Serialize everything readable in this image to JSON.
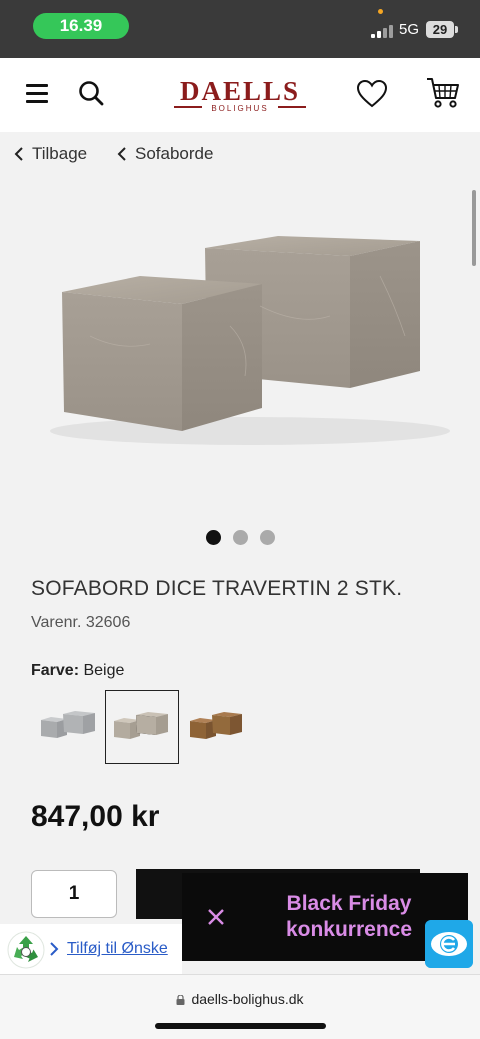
{
  "status_bar": {
    "time": "16.39",
    "network": "5G",
    "battery": "29"
  },
  "header": {
    "logo_main": "DAELLS",
    "logo_sub": "BOLIGHUS"
  },
  "breadcrumbs": {
    "back": "Tilbage",
    "category": "Sofaborde"
  },
  "gallery": {
    "slide_count": 3,
    "active_slide": 1
  },
  "product": {
    "title": "SOFABORD DICE TRAVERTIN 2 STK.",
    "sku": "Varenr. 32606",
    "color_label": "Farve:",
    "color_value": "Beige",
    "swatches": [
      {
        "name": "grey-marble",
        "color": "#b4b6b8"
      },
      {
        "name": "beige",
        "color": "#bdb4a8",
        "selected": true
      },
      {
        "name": "brown",
        "color": "#8b6640"
      }
    ],
    "price": "847,00 kr",
    "quantity": "1"
  },
  "wishlist": {
    "label": "Tilføj til Ønske"
  },
  "promo": {
    "line1": "Black Friday",
    "line2": "konkurrence"
  },
  "browser": {
    "url": "daells-bolighus.dk"
  },
  "colors": {
    "brand": "#8b1c1c",
    "status_green": "#35c759",
    "promo_text": "#d98ce6",
    "link": "#2a5cc7",
    "badge": "#1fa8e8"
  }
}
